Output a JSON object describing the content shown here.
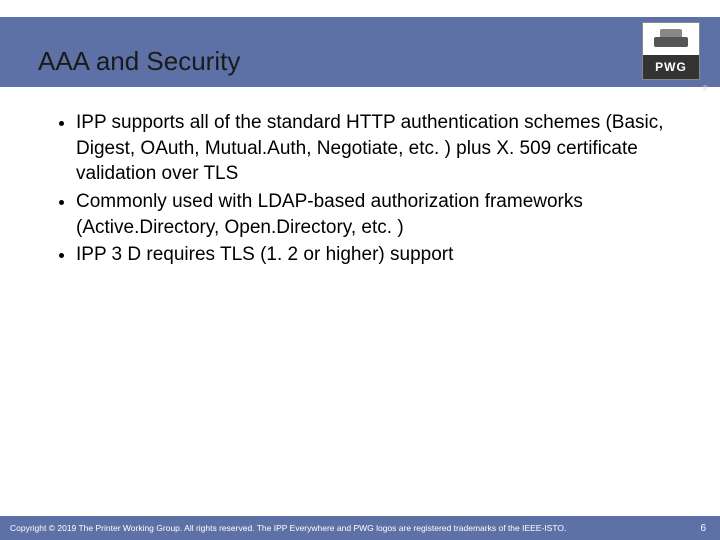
{
  "logo": {
    "abbrev": "PWG",
    "reg_mark": "®"
  },
  "title": "AAA and Security",
  "bullets": [
    "IPP supports all of the standard HTTP authentication schemes (Basic, Digest, OAuth, Mutual.Auth, Negotiate, etc. ) plus X. 509 certificate validation over TLS",
    "Commonly used with LDAP-based authorization frameworks (Active.Directory, Open.Directory, etc. )",
    "IPP 3 D requires TLS (1. 2 or higher) support"
  ],
  "footer": {
    "copyright": "Copyright © 2019 The Printer Working Group. All rights reserved. The IPP Everywhere and PWG logos are registered trademarks of the IEEE-ISTO.",
    "page": "6"
  }
}
